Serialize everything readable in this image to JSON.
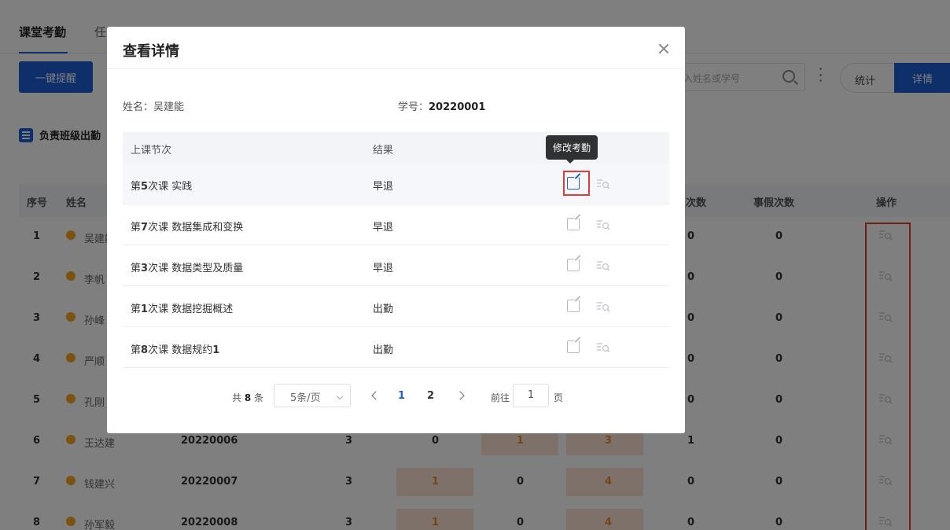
{
  "tabs": [
    {
      "label": "课堂考勤"
    },
    {
      "label": "任"
    }
  ],
  "toolbar": {
    "remind_label": "一键提醒",
    "search_placeholder": "入姓名或学号",
    "stat_label": "统计",
    "detail_label": "详情"
  },
  "section": {
    "title": "负责班级出勤"
  },
  "table": {
    "headers": {
      "index": "序号",
      "name": "姓名",
      "sick": "病假次数",
      "personal": "事假次数",
      "op": "操作"
    },
    "rows": [
      {
        "idx": "1",
        "name": "吴建能",
        "id": "",
        "c1": "",
        "c2": "",
        "c3": "",
        "c4": "",
        "sick": "0",
        "personal": "0"
      },
      {
        "idx": "2",
        "name": "李帆",
        "id": "",
        "c1": "",
        "c2": "",
        "c3": "",
        "c4": "",
        "sick": "0",
        "personal": "0"
      },
      {
        "idx": "3",
        "name": "孙峰",
        "id": "",
        "c1": "",
        "c2": "",
        "c3": "",
        "c4": "",
        "sick": "0",
        "personal": "0"
      },
      {
        "idx": "4",
        "name": "严顺",
        "id": "",
        "c1": "",
        "c2": "",
        "c3": "",
        "c4": "",
        "sick": "0",
        "personal": "0"
      },
      {
        "idx": "5",
        "name": "孔刚",
        "id": "",
        "c1": "",
        "c2": "",
        "c3": "",
        "c4": "",
        "sick": "0",
        "personal": "0"
      },
      {
        "idx": "6",
        "name": "王达建",
        "id": "20220006",
        "c1": "3",
        "c2": "0",
        "c3": "1",
        "c4": "3",
        "sick": "1",
        "personal": "0"
      },
      {
        "idx": "7",
        "name": "钱建兴",
        "id": "20220007",
        "c1": "3",
        "c2": "1",
        "c3": "0",
        "c4": "4",
        "sick": "0",
        "personal": "0"
      },
      {
        "idx": "8",
        "name": "孙军毅",
        "id": "20220008",
        "c1": "3",
        "c2": "1",
        "c3": "0",
        "c4": "4",
        "sick": "0",
        "personal": "0"
      }
    ]
  },
  "modal": {
    "title": "查看详情",
    "name_label": "姓名：",
    "name_value": "吴建能",
    "id_label": "学号：",
    "id_value": "20220001",
    "headers": {
      "session": "上课节次",
      "result": "结果"
    },
    "tooltip": "修改考勤",
    "rows": [
      {
        "prefix": "第",
        "num": "5",
        "suffix": "次课 实践",
        "result": "早退"
      },
      {
        "prefix": "第",
        "num": "7",
        "suffix": "次课 数据集成和变换",
        "result": "早退"
      },
      {
        "prefix": "第",
        "num": "3",
        "suffix": "次课 数据类型及质量",
        "result": "早退"
      },
      {
        "prefix": "第",
        "num": "1",
        "suffix": "次课 数据挖掘概述",
        "result": "出勤"
      },
      {
        "prefix": "第",
        "num": "8",
        "suffix": "次课 数据规约",
        "suffix_num": "1",
        "result": "出勤"
      }
    ],
    "pager": {
      "total_prefix": "共",
      "total": "8",
      "total_suffix": "条",
      "size": "5条/页",
      "pages": [
        "1",
        "2"
      ],
      "goto": "前往",
      "current": "1",
      "page_suffix": "页"
    }
  },
  "colors": {
    "primary": "#1f5fd6",
    "warn": "#f5a623",
    "highlight": "#e03c36",
    "late_bg": "#fbe3d4"
  }
}
